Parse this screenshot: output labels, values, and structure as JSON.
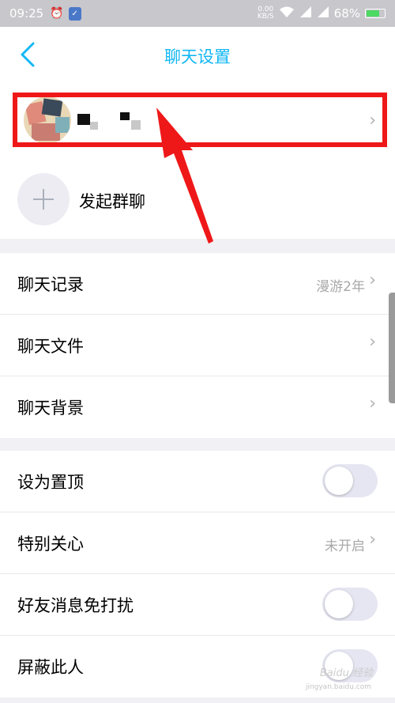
{
  "status_bar": {
    "time": "09:25",
    "net_speed_value": "0.00",
    "net_speed_unit": "KB/S",
    "battery": "68%",
    "battery_level": 0.68,
    "icons": [
      "alarm-icon",
      "shield-icon",
      "wifi-icon",
      "signal-4g-icon",
      "signal-icon",
      "battery-icon"
    ]
  },
  "nav": {
    "title": "聊天设置",
    "back_icon": "chevron-left-icon"
  },
  "group_chat": {
    "label": "发起群聊"
  },
  "chat_section": [
    {
      "label": "聊天记录",
      "value": "漫游2年"
    },
    {
      "label": "聊天文件",
      "value": ""
    },
    {
      "label": "聊天背景",
      "value": ""
    }
  ],
  "settings_section": [
    {
      "label": "设为置顶",
      "type": "toggle",
      "on": false
    },
    {
      "label": "特别关心",
      "type": "link",
      "value": "未开启"
    },
    {
      "label": "好友消息免打扰",
      "type": "toggle",
      "on": false
    },
    {
      "label": "屏蔽此人",
      "type": "toggle",
      "on": false
    }
  ],
  "watermark": {
    "text": "Baidu 经验",
    "sub": "jingyan.baidu.com"
  },
  "colors": {
    "accent": "#12b7f5",
    "annotation": "#ef1818",
    "status_bar": "#c7c7cc"
  }
}
